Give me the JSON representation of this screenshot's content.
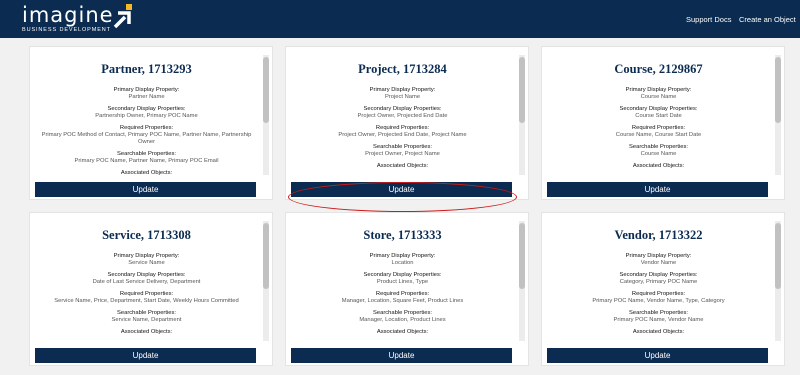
{
  "header": {
    "logo_word": "imagine",
    "logo_sub": "BUSINESS DEVELOPMENT",
    "nav": [
      "Support Docs",
      "Create an Object"
    ]
  },
  "labels": {
    "primary": "Primary Display Property:",
    "secondary": "Secondary Display Properties:",
    "required": "Required Properties:",
    "searchable": "Searchable Properties:",
    "associated": "Associated Objects:"
  },
  "cards": [
    {
      "title": "Partner, 1713293",
      "primary": "Partner Name",
      "secondary": "Partnership Owner, Primary POC Name",
      "required": "Primary POC Method of Contact, Primary POC Name, Partner Name, Partnership Owner",
      "searchable": "Primary POC Name, Partner Name, Primary POC Email",
      "button": "Update"
    },
    {
      "title": "Project, 1713284",
      "primary": "Project Name",
      "secondary": "Project Owner, Projected End Date",
      "required": "Project Owner, Projected End Date, Project Name",
      "searchable": "Project Owner, Project Name",
      "button": "Update"
    },
    {
      "title": "Course, 2129867",
      "primary": "Course Name",
      "secondary": "Course Start Date",
      "required": "Course Name, Course Start Date",
      "searchable": "Course Name",
      "button": "Update"
    },
    {
      "title": "Service, 1713308",
      "primary": "Service Name",
      "secondary": "Date of Last Service Delivery, Department",
      "required": "Service Name, Price, Department, Start Date, Weekly Hours Committed",
      "searchable": "Service Name, Department",
      "button": "Update"
    },
    {
      "title": "Store, 1713333",
      "primary": "Location",
      "secondary": "Product Lines, Type",
      "required": "Manager, Location, Square Feet, Product Lines",
      "searchable": "Manager, Location, Product Lines",
      "button": "Update"
    },
    {
      "title": "Vendor, 1713322",
      "primary": "Vendor Name",
      "secondary": "Category, Primary POC Name",
      "required": "Primary POC Name, Vendor Name, Type, Category",
      "searchable": "Primary POC Name, Vendor Name",
      "button": "Update"
    }
  ]
}
